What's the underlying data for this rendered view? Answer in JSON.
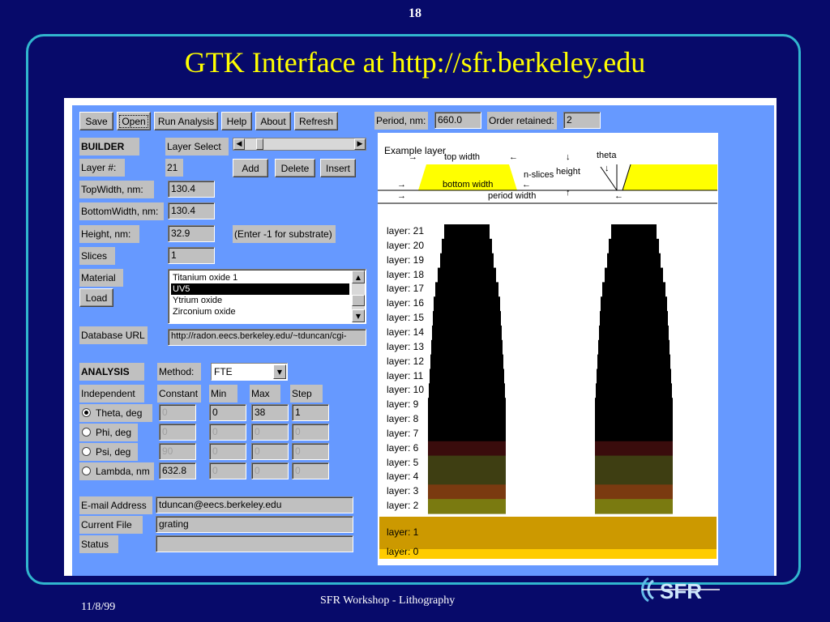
{
  "slide": {
    "number": "18",
    "title": "GTK Interface at http://sfr.berkeley.edu",
    "date": "11/8/99",
    "footer": "SFR Workshop - Lithography",
    "logo_text": "SFR"
  },
  "toolbar": {
    "save": "Save",
    "open": "Open",
    "run_analysis": "Run Analysis",
    "help": "Help",
    "about": "About",
    "refresh": "Refresh"
  },
  "grating": {
    "period_label": "Period, nm:",
    "period_value": "660.0",
    "order_label": "Order retained:",
    "order_value": "2"
  },
  "builder": {
    "heading": "BUILDER",
    "layer_select_label": "Layer Select",
    "layer_num_label": "Layer #:",
    "layer_num_value": "21",
    "add": "Add",
    "delete": "Delete",
    "insert": "Insert",
    "topwidth_label": "TopWidth, nm:",
    "topwidth_value": "130.4",
    "bottomwidth_label": "BottomWidth, nm:",
    "bottomwidth_value": "130.4",
    "height_label": "Height, nm:",
    "height_value": "32.9",
    "height_hint": "(Enter -1 for substrate)",
    "slices_label": "Slices",
    "slices_value": "1",
    "material_label": "Material",
    "load": "Load",
    "materials": [
      "Titanium oxide 1",
      "UV5",
      "Ytrium oxide",
      "Zirconium oxide"
    ],
    "selected_material": "UV5",
    "database_label": "Database URL",
    "database_value": "http://radon.eecs.berkeley.edu/~tduncan/cgi-"
  },
  "analysis": {
    "heading": "ANALYSIS",
    "method_label": "Method:",
    "method_value": "FTE",
    "col_independent": "Independent",
    "col_constant": "Constant",
    "col_min": "Min",
    "col_max": "Max",
    "col_step": "Step",
    "rows": [
      {
        "label": "Theta, deg",
        "selected": true,
        "constant": "0",
        "min": "0",
        "max": "38",
        "step": "1"
      },
      {
        "label": "Phi, deg",
        "selected": false,
        "constant": "0",
        "min": "0",
        "max": "0",
        "step": "0"
      },
      {
        "label": "Psi, deg",
        "selected": false,
        "constant": "90",
        "min": "0",
        "max": "0",
        "step": "0"
      },
      {
        "label": "Lambda, nm",
        "selected": false,
        "constant": "632.8",
        "min": "0",
        "max": "0",
        "step": "0"
      }
    ]
  },
  "info": {
    "email_label": "E-mail Address",
    "email_value": "tduncan@eecs.berkeley.edu",
    "file_label": "Current File",
    "file_value": "grating",
    "status_label": "Status",
    "status_value": ""
  },
  "diagram": {
    "example_layer": "Example layer",
    "top_width": "top width",
    "bottom_width": "bottom width",
    "n_slices": "n-slices",
    "height": "height",
    "theta": "theta",
    "period_width": "period width"
  },
  "layers": {
    "labels": [
      "layer: 21",
      "layer: 20",
      "layer: 19",
      "layer: 18",
      "layer: 17",
      "layer: 16",
      "layer: 15",
      "layer: 14",
      "layer: 13",
      "layer: 12",
      "layer: 11",
      "layer: 10",
      "layer: 9",
      "layer: 8",
      "layer: 7",
      "layer: 6",
      "layer: 5",
      "layer: 4",
      "layer: 3",
      "layer: 2"
    ],
    "substrate_label": "layer: 1",
    "base_label": "layer: 0",
    "colors": {
      "resist": "#000000",
      "layer6": "#3a0c0c",
      "layer5": "#3e3e12",
      "layer4": "#3e3e12",
      "layer3": "#7a3a10",
      "layer2": "#7a7a10",
      "substrate": "#cc9900",
      "base": "#ffcc00",
      "example_fill": "#ffff00"
    }
  }
}
